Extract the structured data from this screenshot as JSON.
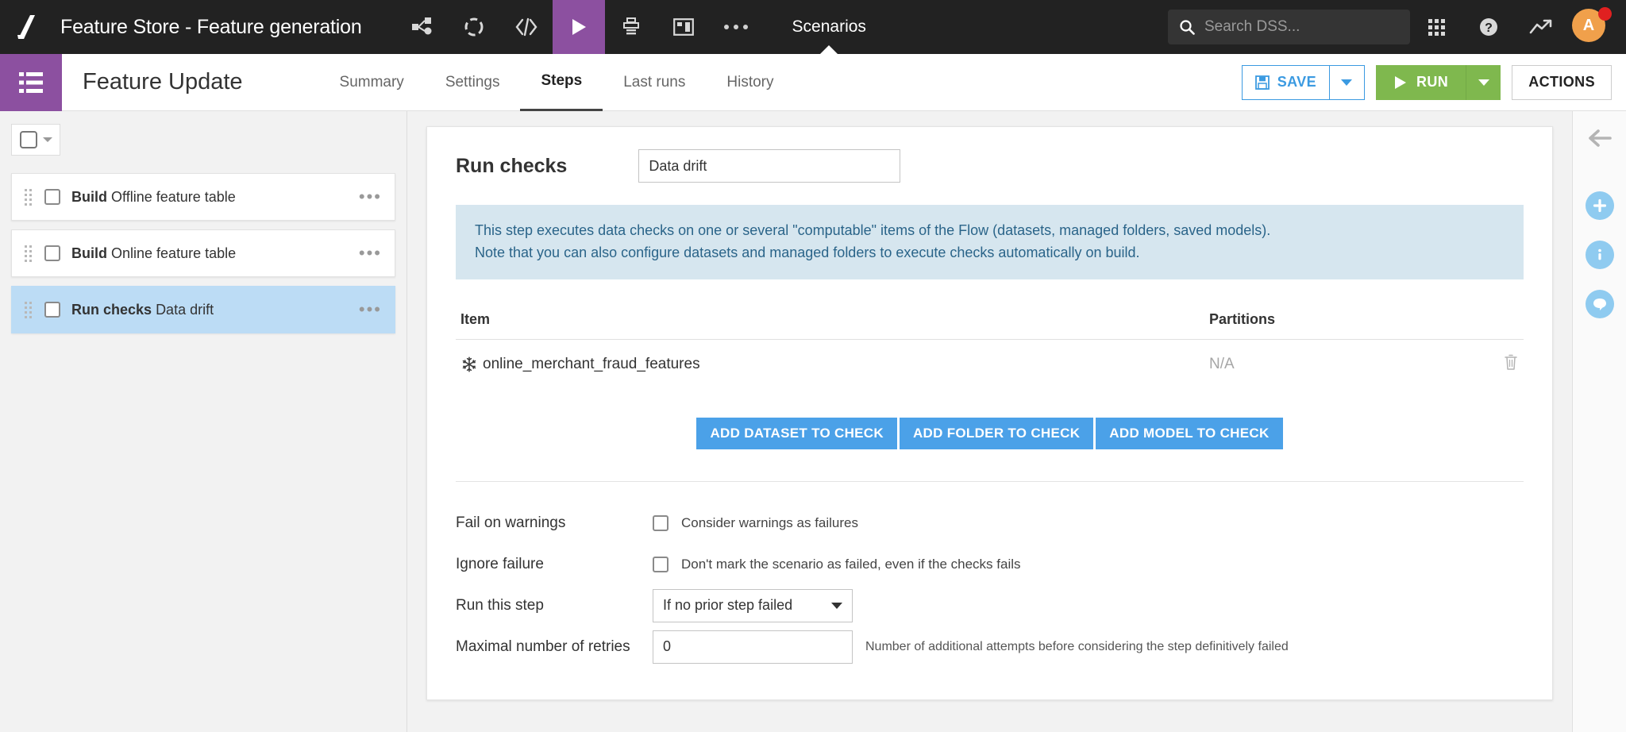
{
  "topbar": {
    "logo": "dataiku-logo-icon",
    "project_title": "Feature Store - Feature generation",
    "nav_icons": [
      {
        "name": "flow-icon",
        "label": "Flow"
      },
      {
        "name": "lab-icon",
        "label": "Lab"
      },
      {
        "name": "code-icon",
        "label": "Code"
      },
      {
        "name": "scenarios-play-icon",
        "label": "Automation",
        "active": true
      },
      {
        "name": "jobs-icon",
        "label": "Jobs"
      },
      {
        "name": "dashboard-icon",
        "label": "Dashboards"
      },
      {
        "name": "more-icon",
        "label": "More"
      }
    ],
    "section_label": "Scenarios",
    "search": {
      "placeholder": "Search DSS...",
      "value": ""
    },
    "apps_icon": "apps-grid-icon",
    "help_icon": "help-icon",
    "activity_icon": "activity-trend-icon",
    "avatar_initial": "A",
    "avatar_color": "#f0a04b",
    "badge_color": "#e02020"
  },
  "subheader": {
    "icon": "scenario-list-icon",
    "title": "Feature Update",
    "tabs": [
      {
        "label": "Summary",
        "active": false
      },
      {
        "label": "Settings",
        "active": false
      },
      {
        "label": "Steps",
        "active": true
      },
      {
        "label": "Last runs",
        "active": false
      },
      {
        "label": "History",
        "active": false
      }
    ],
    "save_label": "SAVE",
    "save_icon": "floppy-save-icon",
    "run_label": "RUN",
    "run_icon": "play-icon",
    "actions_label": "ACTIONS",
    "save_color": "#3b9ae1",
    "run_color": "#7fb84e"
  },
  "steps_pane": {
    "select_all_checked": false,
    "steps": [
      {
        "type": "Build",
        "name": "Offline feature table",
        "selected": false,
        "checked": false
      },
      {
        "type": "Build",
        "name": "Online feature table",
        "selected": false,
        "checked": false
      },
      {
        "type": "Run checks",
        "name": "Data drift",
        "selected": true,
        "checked": false
      }
    ],
    "menu_dots": "•••"
  },
  "step_detail": {
    "title": "Run checks",
    "name_value": "Data drift",
    "name_placeholder": "",
    "info_line_1": "This step executes data checks on one or several \"computable\" items of the Flow (datasets, managed folders, saved models).",
    "info_line_2": "Note that you can also configure datasets and managed folders to execute checks automatically on build.",
    "table": {
      "columns": [
        "Item",
        "Partitions"
      ],
      "rows": [
        {
          "icon": "snowflake-dataset-icon",
          "item": "online_merchant_fraud_features",
          "partitions": "N/A",
          "delete_icon": "trash-icon"
        }
      ]
    },
    "add_buttons": [
      "ADD DATASET TO CHECK",
      "ADD FOLDER TO CHECK",
      "ADD MODEL TO CHECK"
    ],
    "add_button_color": "#4ba1e8",
    "settings": [
      {
        "label": "Fail on warnings",
        "control": "checkbox",
        "checked": false,
        "description": "Consider warnings as failures"
      },
      {
        "label": "Ignore failure",
        "control": "checkbox",
        "checked": false,
        "description": "Don't mark the scenario as failed, even if the checks fails"
      },
      {
        "label": "Run this step",
        "control": "select",
        "value": "If no prior step failed",
        "description": ""
      },
      {
        "label": "Maximal number of retries",
        "control": "text",
        "value": "0",
        "description": "Number of additional attempts before considering the step definitively failed"
      }
    ]
  },
  "right_rail": {
    "collapse_icon": "arrow-left-icon",
    "items": [
      {
        "name": "add-icon",
        "glyph": "+"
      },
      {
        "name": "info-icon",
        "glyph": "i"
      },
      {
        "name": "discussions-icon",
        "glyph": "●"
      }
    ],
    "accent": "#8fcbf0"
  }
}
